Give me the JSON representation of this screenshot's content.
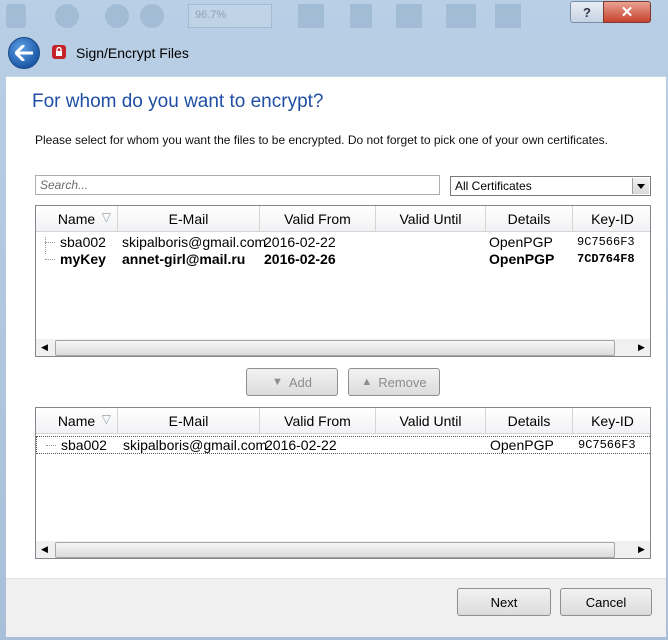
{
  "window": {
    "help_glyph": "?",
    "close_glyph": "✕",
    "zoom_ghost": "96.7%"
  },
  "nav": {
    "title": "Sign/Encrypt Files",
    "back_icon": "back-arrow-icon",
    "app_icon": "kleopatra-icon"
  },
  "page": {
    "heading": "For whom do you want to encrypt?",
    "intro": "Please select for whom you want the files to be encrypted. Do not forget to pick one of your own certificates."
  },
  "search": {
    "placeholder": "Search..."
  },
  "filter": {
    "selected": "All Certificates"
  },
  "columns": [
    "Name",
    "E-Mail",
    "Valid From",
    "Valid Until",
    "Details",
    "Key-ID"
  ],
  "available": [
    {
      "name": "sba002",
      "email": "skipalboris@gmail.com",
      "valid_from": "2016-02-22",
      "valid_until": "",
      "details": "OpenPGP",
      "key_id": "9C7566F3",
      "bold": false
    },
    {
      "name": "myKey",
      "email": "annet-girl@mail.ru",
      "valid_from": "2016-02-26",
      "valid_until": "",
      "details": "OpenPGP",
      "key_id": "7CD764F8",
      "bold": true
    }
  ],
  "selected": [
    {
      "name": "sba002",
      "email": "skipalboris@gmail.com",
      "valid_from": "2016-02-22",
      "valid_until": "",
      "details": "OpenPGP",
      "key_id": "9C7566F3"
    }
  ],
  "actions": {
    "add_label": "Add",
    "remove_label": "Remove"
  },
  "footer": {
    "next_label": "Next",
    "cancel_label": "Cancel"
  },
  "colors": {
    "heading": "#1f4fa4",
    "close_button": "#c8412c",
    "app_icon": "#c4232a"
  }
}
